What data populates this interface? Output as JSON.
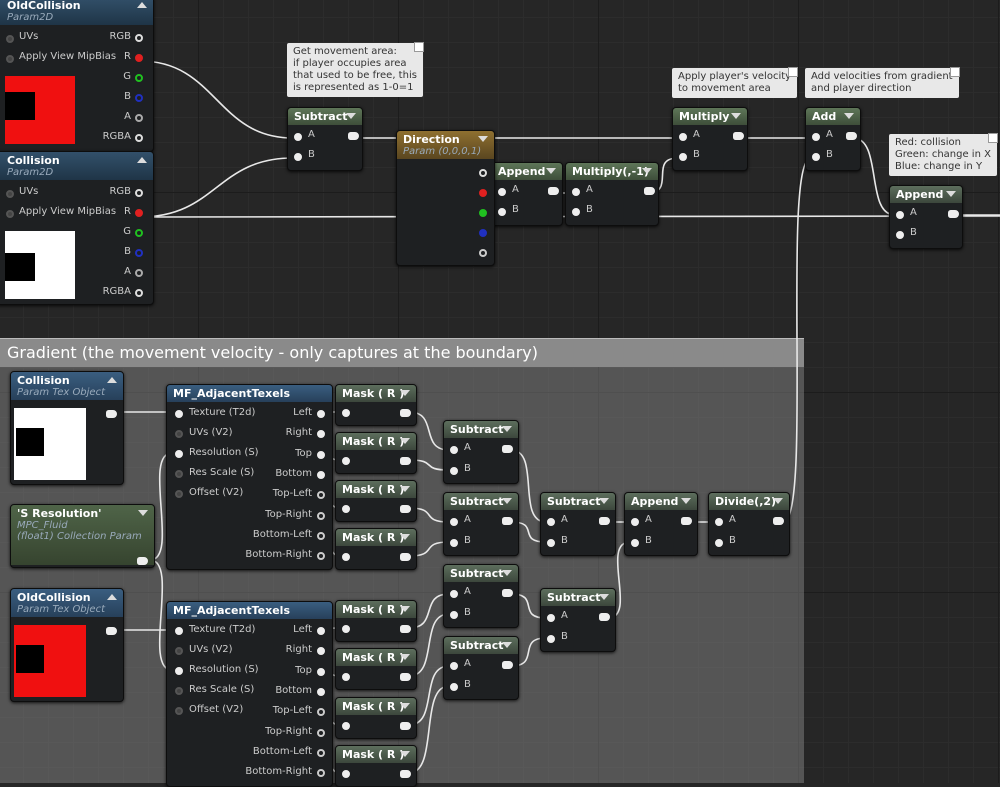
{
  "comment_box": {
    "title": "Gradient (the movement velocity - only captures at the boundary)"
  },
  "colors": {
    "red": "#f01010",
    "white": "#ffffff",
    "black": "#000000",
    "wire": "#e8e8e8"
  },
  "param_nodes": [
    {
      "title": "OldCollision",
      "subtitle": "Param2D",
      "inputs": [
        "UVs",
        "Apply View MipBias"
      ],
      "outputs": [
        "RGB",
        "R",
        "G",
        "B",
        "A",
        "RGBA"
      ],
      "preview": "red"
    },
    {
      "title": "Collision",
      "subtitle": "Param2D",
      "inputs": [
        "UVs",
        "Apply View MipBias"
      ],
      "outputs": [
        "RGB",
        "R",
        "G",
        "B",
        "A",
        "RGBA"
      ],
      "preview": "white"
    }
  ],
  "nodes": {
    "subtract_top": {
      "title": "Subtract",
      "pins": [
        "A",
        "B"
      ]
    },
    "direction": {
      "title": "Direction",
      "subtitle": "Param (0,0,0,1)"
    },
    "append_1": {
      "title": "Append",
      "pins": [
        "A",
        "B"
      ]
    },
    "multiply_neg": {
      "title": "Multiply(,-1)",
      "pins": [
        "A",
        "B"
      ]
    },
    "multiply": {
      "title": "Multiply",
      "pins": [
        "A",
        "B"
      ]
    },
    "add": {
      "title": "Add",
      "pins": [
        "A",
        "B"
      ]
    },
    "append_final": {
      "title": "Append",
      "pins": [
        "A",
        "B"
      ]
    }
  },
  "comments": {
    "movement_area": "Get movement area:\nif player occupies area\nthat used to be free, this\nis represented as 1-0=1",
    "apply_velocity": "Apply player's velocity\nto movement area",
    "add_velocities": "Add velocities from gradient\nand player direction",
    "channels": "Red: collision\nGreen: change in X\nBlue: change in Y"
  },
  "gradient": {
    "tex_objects": [
      {
        "title": "Collision",
        "subtitle": "Param Tex Object",
        "preview": "white"
      },
      {
        "title": "OldCollision",
        "subtitle": "Param Tex Object",
        "preview": "red"
      }
    ],
    "resolution": {
      "title": "'S Resolution'",
      "subtitle1": "MPC_Fluid",
      "subtitle2": "(float1) Collection Param"
    },
    "adjacent": {
      "title": "MF_AdjacentTexels",
      "inputs": [
        "Texture (T2d)",
        "UVs (V2)",
        "Resolution (S)",
        "Res Scale (S)",
        "Offset (V2)"
      ],
      "outputs": [
        "Left",
        "Right",
        "Top",
        "Bottom",
        "Top-Left",
        "Top-Right",
        "Bottom-Left",
        "Bottom-Right"
      ]
    },
    "adjacent_2": {
      "title": "MF_AdjacentTexels",
      "inputs": [
        "Texture (T2d)",
        "UVs (V2)",
        "Resolution (S)",
        "Res Scale (S)",
        "Offset (V2)"
      ],
      "outputs": [
        "Left",
        "Right",
        "Top",
        "Bottom",
        "Top-Left",
        "Top-Right",
        "Bottom-Left",
        "Bottom-Right"
      ]
    },
    "mask_label": "Mask ( R )",
    "subtract_label": "Subtract",
    "append_label": "Append",
    "divide_label": "Divide(,2)",
    "pin_a": "A",
    "pin_b": "B"
  }
}
